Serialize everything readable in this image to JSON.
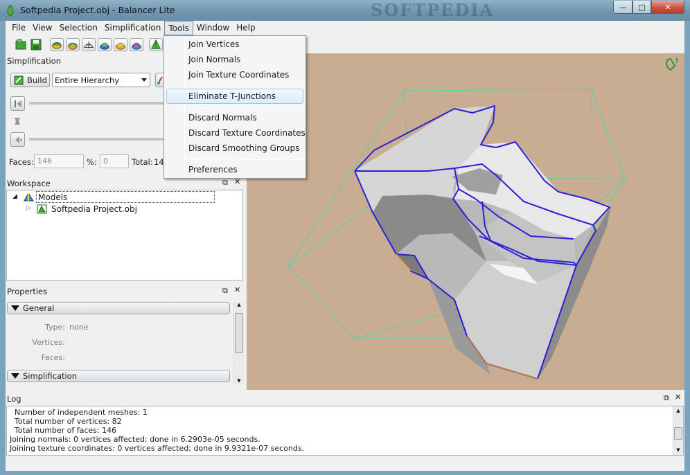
{
  "window": {
    "title": "Softpedia Project.obj - Balancer Lite",
    "watermark": "SOFTPEDIA",
    "controls": {
      "minimize": "—",
      "maximize": "□",
      "close": "✕"
    }
  },
  "menubar": {
    "items": [
      "File",
      "View",
      "Selection",
      "Simplification",
      "Tools",
      "Window",
      "Help"
    ],
    "open_menu": "Tools"
  },
  "tools_menu": {
    "items": [
      "Join Vertices",
      "Join Normals",
      "Join Texture Coordinates",
      "Eliminate T-Junctions",
      "Discard Normals",
      "Discard Texture Coordinates",
      "Discard Smoothing Groups",
      "Preferences"
    ],
    "highlighted": "Eliminate T-Junctions"
  },
  "toolbar": {
    "icons": [
      "open-file-icon",
      "save-icon",
      "mesh-view-1-icon",
      "mesh-view-2-icon",
      "mesh-view-3-icon",
      "mesh-view-4-icon",
      "mesh-view-5-icon",
      "mesh-view-6-icon",
      "pyramid-icon"
    ]
  },
  "simplification": {
    "title": "Simplification",
    "build_label": "Build",
    "scope_value": "Entire Hierarchy",
    "faces_label": "Faces:",
    "faces_value": "146",
    "percent_label": "%:",
    "percent_value": "0",
    "total_label": "Total:",
    "total_value": "146"
  },
  "workspace": {
    "title": "Workspace",
    "root": "Models",
    "child": "Softpedia Project.obj"
  },
  "properties": {
    "title": "Properties",
    "general_label": "General",
    "type_label": "Type:",
    "type_value": "none",
    "vertices_label": "Vertices:",
    "faces_label": "Faces:",
    "simplification_label": "Simplification"
  },
  "log": {
    "title": "Log",
    "lines": [
      "  Number of independent meshes: 1",
      "  Total number of vertices: 82",
      "  Total number of faces: 146",
      "Joining normals: 0 vertices affected; done in 6.2903e-05 seconds.",
      "Joining texture coordinates: 0 vertices affected; done in 9.9321e-07 seconds."
    ]
  },
  "colors": {
    "viewport_bg": "#c8ad92",
    "bounding_box": "#4fd3b0",
    "mesh_edges": "#2a1fd6",
    "titlebar": "#6e93ad"
  }
}
